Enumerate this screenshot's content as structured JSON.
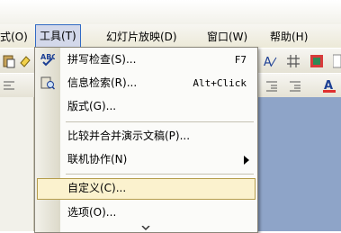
{
  "menubar": {
    "items": [
      {
        "label": "式(O)"
      },
      {
        "label": "工具(T)"
      },
      {
        "label": "幻灯片放映(D)"
      },
      {
        "label": "窗口(W)"
      },
      {
        "label": "帮助(H)"
      }
    ]
  },
  "tools_menu": {
    "items": [
      {
        "label": "拼写检查(S)...",
        "shortcut": "F7",
        "icon": "spelling-icon"
      },
      {
        "label": "信息检索(R)...",
        "shortcut": "Alt+Click",
        "icon": "research-icon"
      },
      {
        "label": "版式(G)..."
      },
      {
        "label": "比较并合并演示文稿(P)..."
      },
      {
        "label": "联机协作(N)",
        "submenu": true
      },
      {
        "label": "自定义(C)...",
        "highlighted": true
      },
      {
        "label": "选项(O)..."
      }
    ]
  },
  "colors": {
    "menu_highlight": "#fbf2ce",
    "menubar_active": "#d3d8ea",
    "slide_background": "#8ea4c8"
  }
}
